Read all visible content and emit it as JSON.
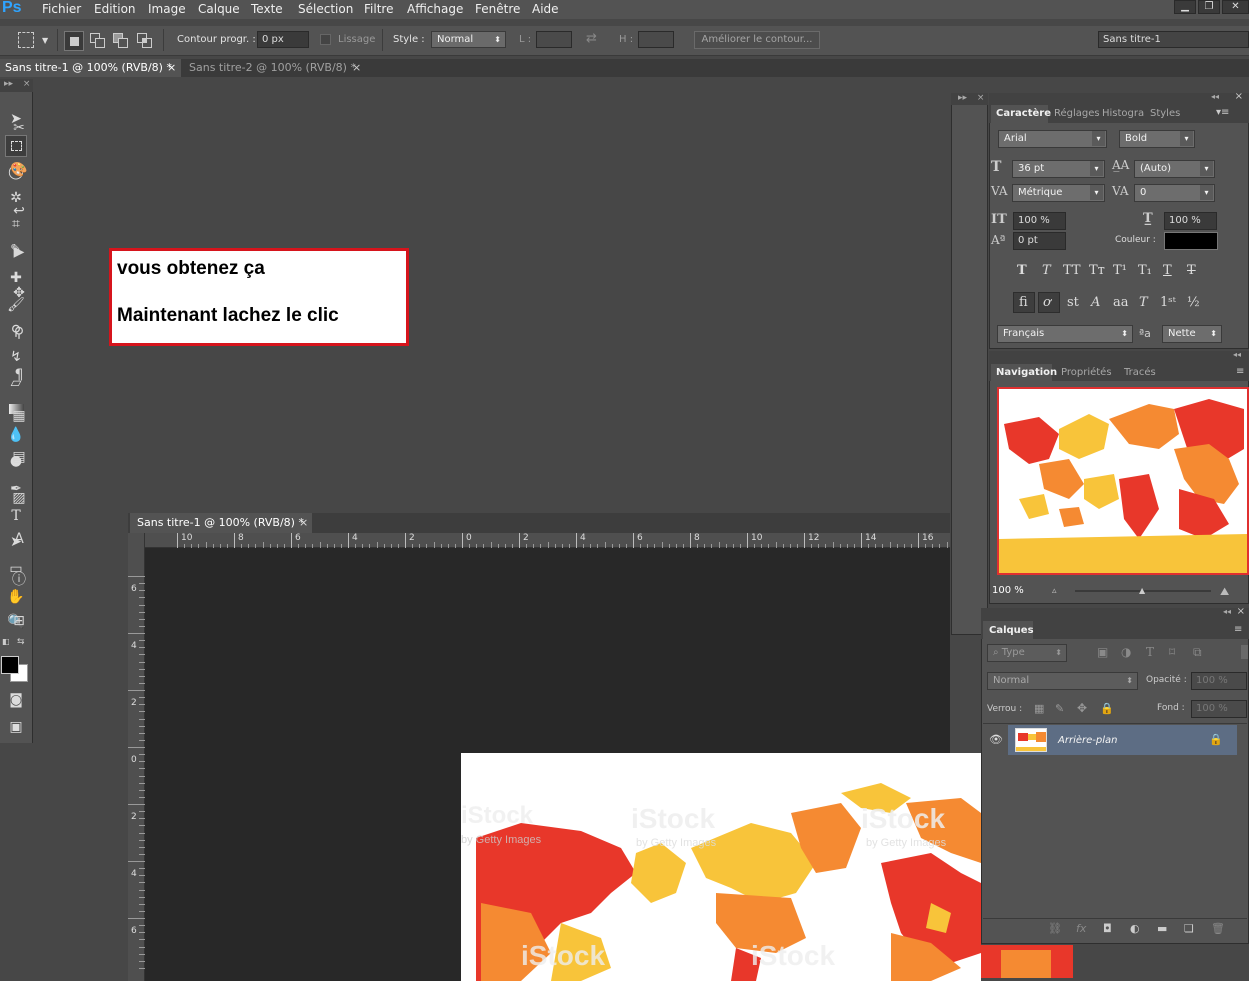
{
  "app": {
    "logo": "Ps"
  },
  "menu": [
    "Fichier",
    "Edition",
    "Image",
    "Calque",
    "Texte",
    "Sélection",
    "Filtre",
    "Affichage",
    "Fenêtre",
    "Aide"
  ],
  "options_bar": {
    "contour_label": "Contour progr. :",
    "contour_value": "0 px",
    "lissage_label": "Lissage",
    "style_label": "Style :",
    "style_value": "Normal",
    "l_label": "L :",
    "h_label": "H :",
    "refine_button": "Améliorer le contour...",
    "workspace": "Sans titre-1"
  },
  "doc_tabs": [
    {
      "label": "Sans titre-1 @ 100% (RVB/8) *",
      "active": true
    },
    {
      "label": "Sans titre-2 @ 100% (RVB/8) *",
      "active": false
    }
  ],
  "annotation": {
    "line1": "vous obtenez ça",
    "line2": "Maintenant lachez le clic"
  },
  "floating_doc": {
    "title": "Sans titre-1 @ 100% (RVB/8) *",
    "h_ruler_labels": [
      "10",
      "8",
      "6",
      "4",
      "2",
      "0",
      "2",
      "4",
      "6",
      "8",
      "10",
      "12",
      "14",
      "16"
    ],
    "v_ruler_labels": [
      "6",
      "4",
      "2",
      "0",
      "2",
      "4",
      "6"
    ]
  },
  "character_panel": {
    "tabs": [
      "Caractère",
      "Réglages",
      "Histogra",
      "Styles"
    ],
    "font_family": "Arial",
    "font_style": "Bold",
    "size": "36 pt",
    "leading": "(Auto)",
    "kerning": "Métrique",
    "tracking": "0",
    "vscale": "100 %",
    "hscale": "100 %",
    "baseline": "0 pt",
    "color_label": "Couleur :",
    "color_value": "#000000",
    "language": "Français",
    "antialias": "Nette"
  },
  "navigator_panel": {
    "tabs": [
      "Navigation",
      "Propriétés",
      "Tracés"
    ],
    "zoom": "100 %"
  },
  "layers_panel": {
    "title": "Calques",
    "filter": "Type",
    "blend_mode": "Normal",
    "opacity_label": "Opacité :",
    "opacity_value": "100 %",
    "lock_label": "Verrou :",
    "fill_label": "Fond :",
    "fill_value": "100 %",
    "layers": [
      {
        "name": "Arrière-plan",
        "visible": true,
        "locked": true
      }
    ]
  },
  "map_watermark": {
    "brand": "iStock",
    "sub": "by Getty Images"
  },
  "colors": {
    "accent": "#2fa4ff",
    "annotation_border": "#d6141c",
    "map_red": "#e8372a",
    "map_orange": "#f58a32",
    "map_yellow": "#f8c43a"
  }
}
